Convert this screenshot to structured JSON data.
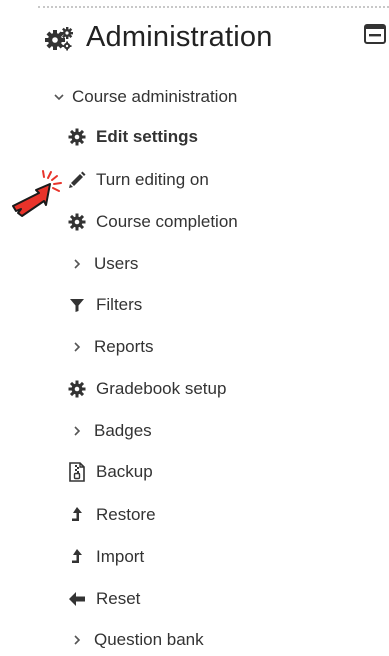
{
  "block": {
    "title": "Administration",
    "title_icon": "gears-icon",
    "collapse_icon": "minus-box-icon"
  },
  "menu": {
    "section_label": "Course administration",
    "items": [
      {
        "label": "Edit settings",
        "icon": "gear-icon",
        "bold": true
      },
      {
        "label": "Turn editing on",
        "icon": "pencil-icon"
      },
      {
        "label": "Course completion",
        "icon": "gear-icon"
      },
      {
        "label": "Users",
        "icon": "chevron-right-icon"
      },
      {
        "label": "Filters",
        "icon": "filter-icon"
      },
      {
        "label": "Reports",
        "icon": "chevron-right-icon"
      },
      {
        "label": "Gradebook setup",
        "icon": "gear-icon"
      },
      {
        "label": "Badges",
        "icon": "chevron-right-icon"
      },
      {
        "label": "Backup",
        "icon": "file-archive-icon"
      },
      {
        "label": "Restore",
        "icon": "level-up-icon"
      },
      {
        "label": "Import",
        "icon": "level-up-icon"
      },
      {
        "label": "Reset",
        "icon": "arrow-left-icon"
      },
      {
        "label": "Question bank",
        "icon": "chevron-right-icon"
      }
    ]
  },
  "pointer": {
    "icon": "hand-pointer-icon",
    "color": "#e8332a"
  }
}
